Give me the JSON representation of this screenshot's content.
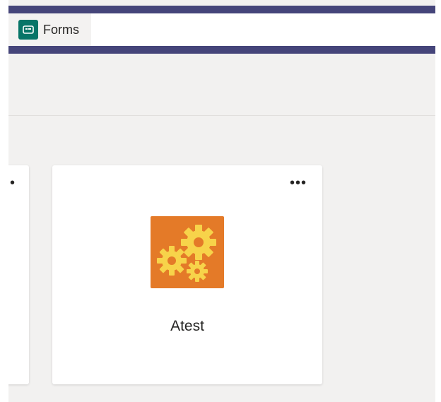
{
  "tabs": [
    {
      "label": "Forms",
      "icon": "forms-icon",
      "active": true
    }
  ],
  "cards": [
    {
      "name": "",
      "more_label": "•"
    },
    {
      "name": "Atest",
      "icon": "gears-icon",
      "more_label": "•••"
    }
  ],
  "colors": {
    "top_band": "#45457a",
    "forms_icon": "#077568",
    "app_tile": "#e47a28",
    "gears": "#f7d34a"
  }
}
